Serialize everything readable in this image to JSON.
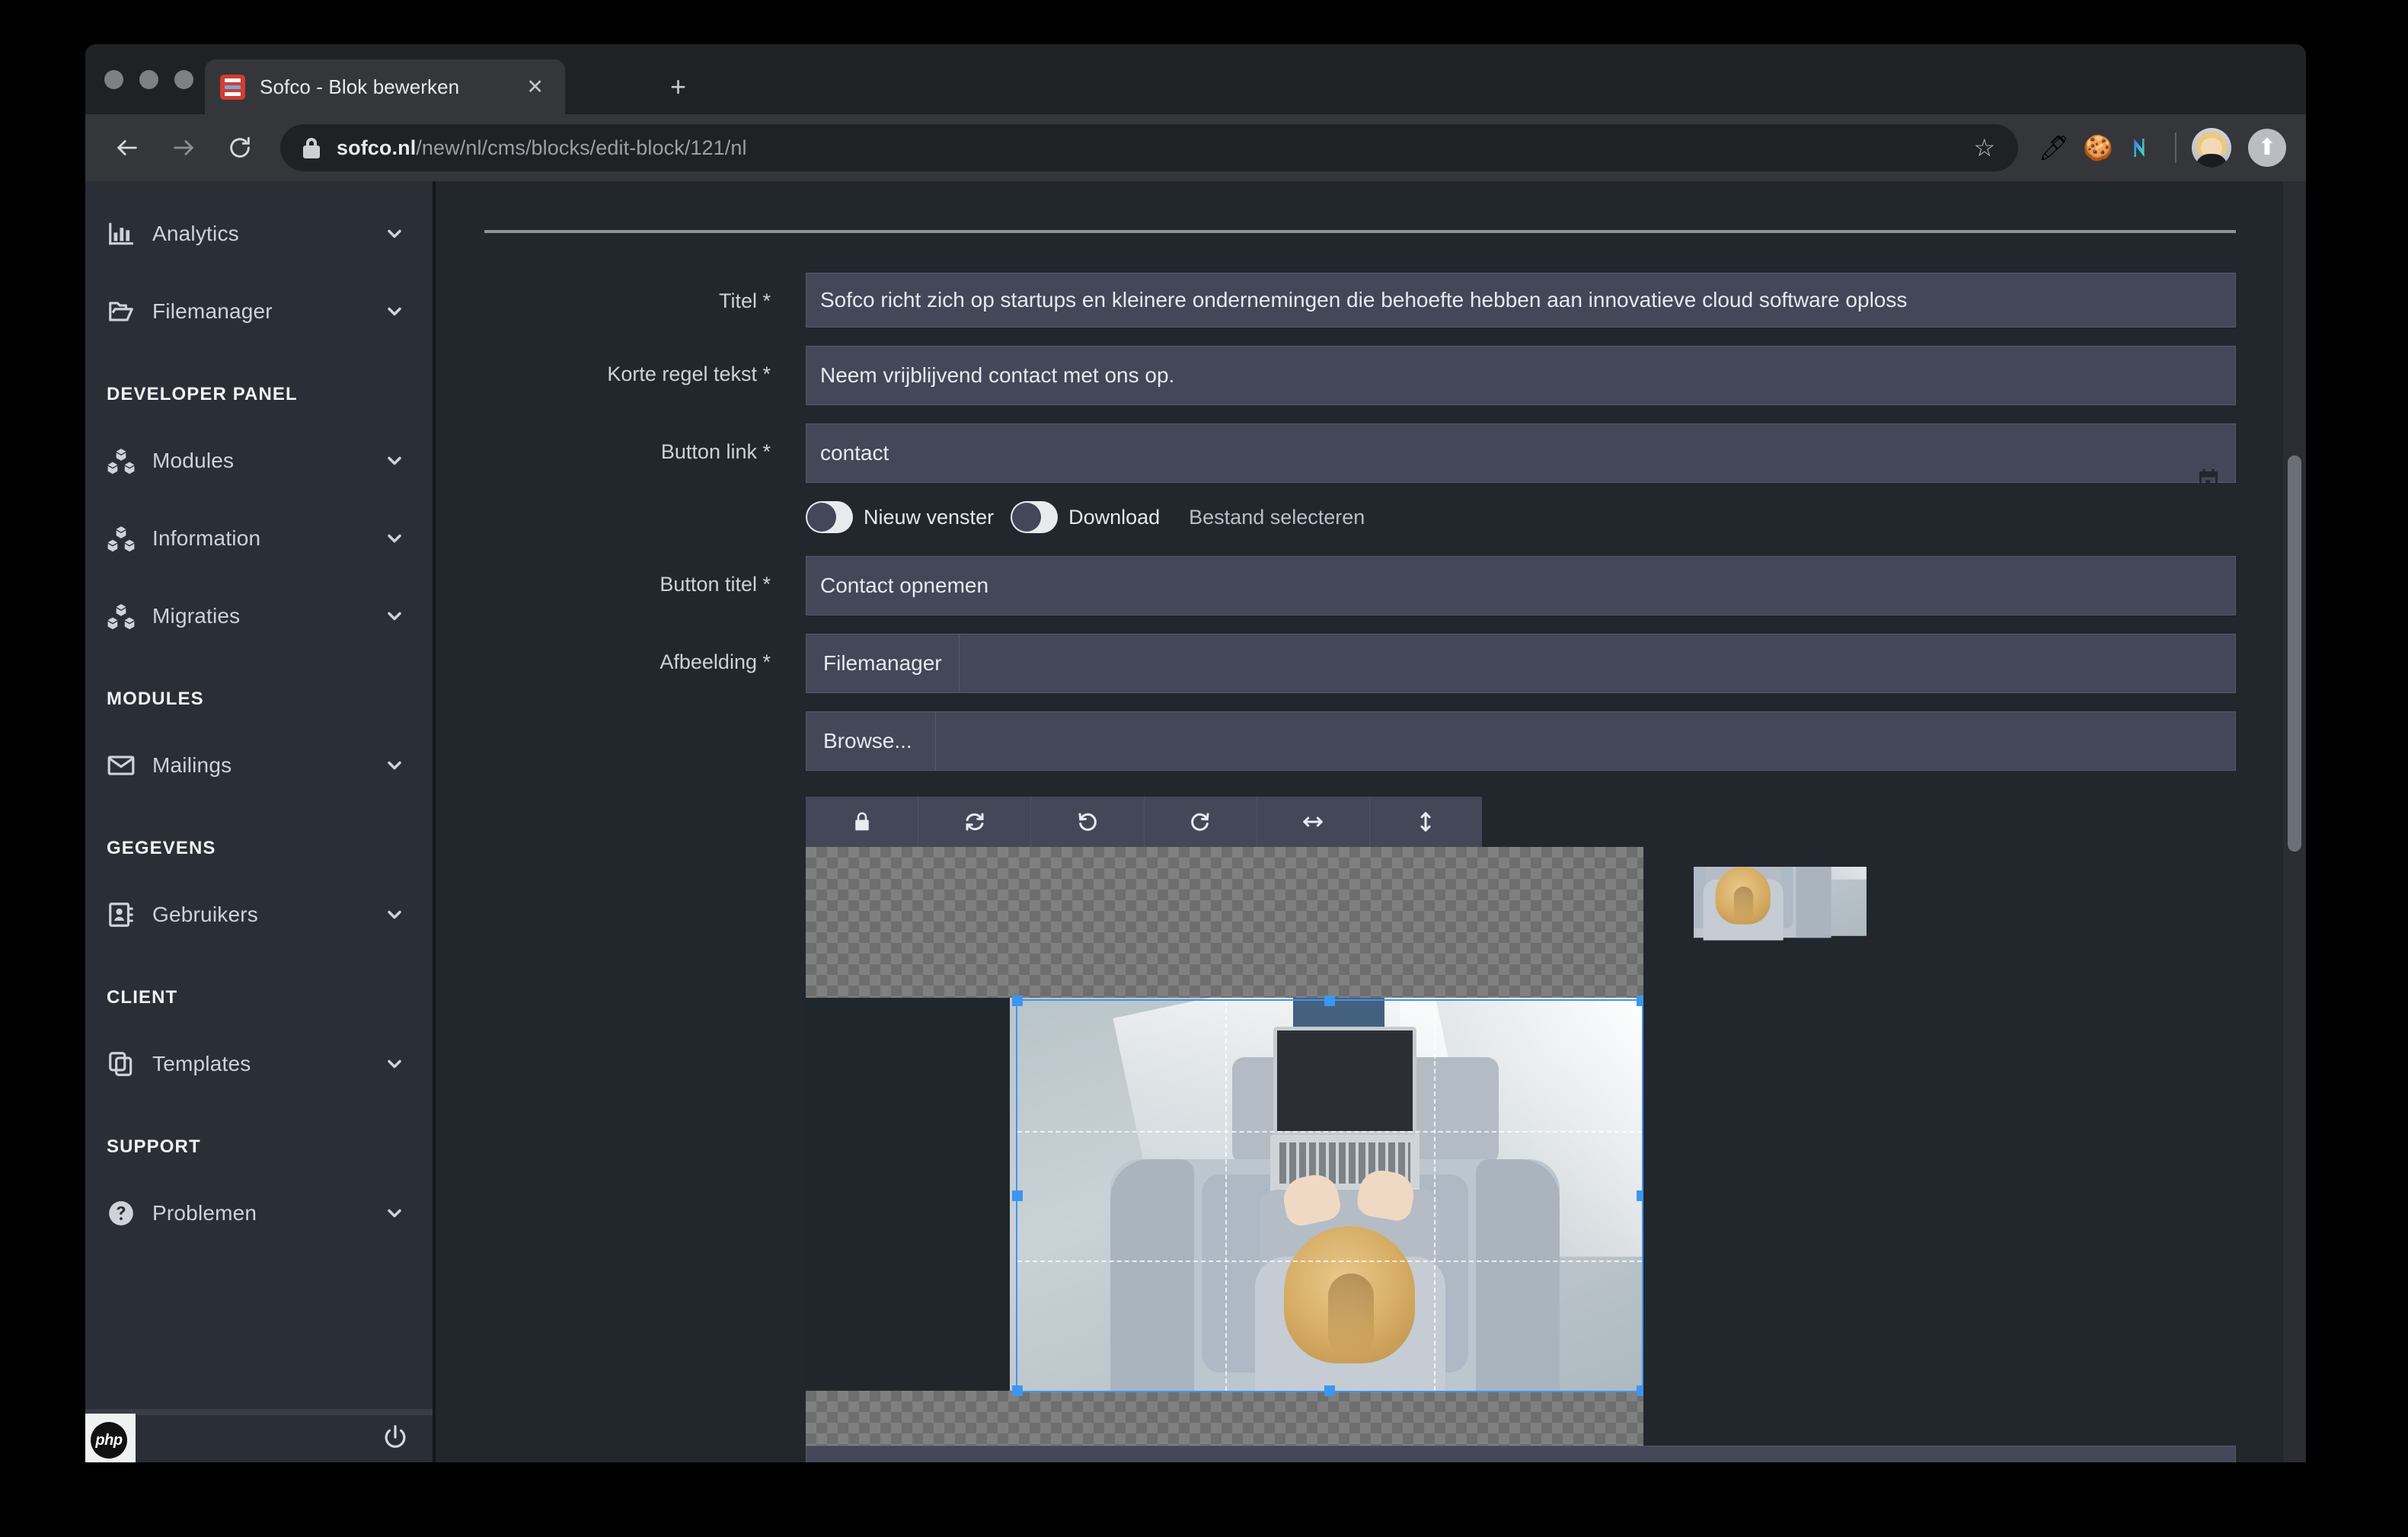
{
  "browser": {
    "tab_title": "Sofco - Blok bewerken",
    "tab_close_icon": "close-icon",
    "new_tab_icon": "plus-icon",
    "back_icon": "back-arrow-icon",
    "forward_icon": "forward-arrow-icon",
    "reload_icon": "reload-icon",
    "lock_icon": "lock-icon",
    "url_domain": "sofco.nl",
    "url_path": "/new/nl/cms/blocks/edit-block/121/nl",
    "bookmark_icon": "star-icon",
    "extensions": [
      {
        "name": "eyedropper-icon",
        "glyph": "🖊"
      },
      {
        "name": "cookie-icon",
        "glyph": "🍪"
      },
      {
        "name": "notion-extension-icon",
        "glyph": "N"
      }
    ],
    "profile_icon": "avatar",
    "upload_icon": "upload-arrow-icon"
  },
  "sidebar": {
    "items": [
      {
        "type": "link",
        "label": "Analytics",
        "icon": "bar-chart-icon",
        "chevron": "chevron-down-icon"
      },
      {
        "type": "link",
        "label": "Filemanager",
        "icon": "folder-open-icon",
        "chevron": "chevron-down-icon"
      },
      {
        "type": "section",
        "label": "DEVELOPER PANEL"
      },
      {
        "type": "link",
        "label": "Modules",
        "icon": "cubes-icon",
        "chevron": "chevron-down-icon"
      },
      {
        "type": "link",
        "label": "Information",
        "icon": "cubes-icon",
        "chevron": "chevron-down-icon"
      },
      {
        "type": "link",
        "label": "Migraties",
        "icon": "cubes-icon",
        "chevron": "chevron-down-icon"
      },
      {
        "type": "section",
        "label": "MODULES"
      },
      {
        "type": "link",
        "label": "Mailings",
        "icon": "envelope-icon",
        "chevron": "chevron-down-icon"
      },
      {
        "type": "section",
        "label": "GEGEVENS"
      },
      {
        "type": "link",
        "label": "Gebruikers",
        "icon": "address-book-icon",
        "chevron": "chevron-down-icon"
      },
      {
        "type": "section",
        "label": "CLIENT"
      },
      {
        "type": "link",
        "label": "Templates",
        "icon": "copy-layers-icon",
        "chevron": "chevron-down-icon"
      },
      {
        "type": "section",
        "label": "SUPPORT"
      },
      {
        "type": "link",
        "label": "Problemen",
        "icon": "question-circle-icon",
        "chevron": "chevron-down-icon"
      }
    ],
    "footer": {
      "badge_label": "php",
      "logout_icon": "power-icon"
    }
  },
  "form": {
    "fields": [
      {
        "label": "Titel *",
        "value": "Sofco richt zich op startups en kleinere ondernemingen die behoefte hebben aan innovatieve cloud software oploss"
      },
      {
        "label": "Korte regel tekst *",
        "value": "Neem vrijblijvend contact met ons op."
      },
      {
        "label": "Button link *",
        "value": "contact",
        "trailing_icon": "calendar-icon"
      },
      {
        "label": "Button titel *",
        "value": "Contact opnemen"
      },
      {
        "label": "Afbeelding *",
        "addon": "Filemanager",
        "value": ""
      }
    ],
    "toggles": [
      {
        "label": "Nieuw venster",
        "state": "off"
      },
      {
        "label": "Download",
        "state": "off"
      }
    ],
    "file_select_label": "Bestand selecteren",
    "browse": {
      "addon": "Browse...",
      "value": ""
    }
  },
  "cropper": {
    "tools": [
      {
        "name": "lock-icon",
        "label": "Lock aspect ratio"
      },
      {
        "name": "reset-icon",
        "label": "Reset"
      },
      {
        "name": "rotate-left-icon",
        "label": "Rotate left"
      },
      {
        "name": "rotate-right-icon",
        "label": "Rotate right"
      },
      {
        "name": "flip-horizontal-icon",
        "label": "Flip horizontal"
      },
      {
        "name": "flip-vertical-icon",
        "label": "Flip vertical"
      }
    ],
    "image_alt": "Persoon van bovenaf op grijze bank met laptop",
    "preview_alt": "Bijgesneden voorbeeld"
  },
  "colors": {
    "accent": "#3e95ef",
    "sidebar_bg": "#2a2e37",
    "content_bg": "#22262d",
    "input_bg": "#434758",
    "browser_chrome": "#35363a"
  }
}
